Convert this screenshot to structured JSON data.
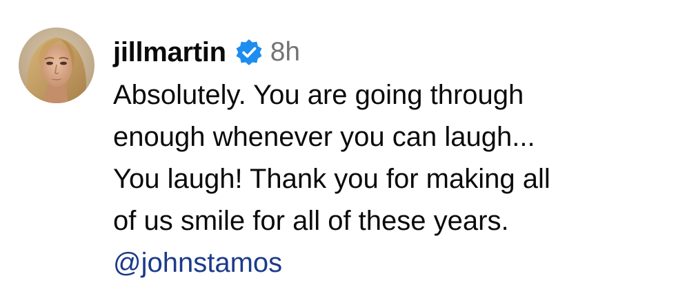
{
  "comment": {
    "username": "jillmartin",
    "verified_icon": "verified-badge-icon",
    "timestamp": "8h",
    "text_lines": [
      "Absolutely. You are going through",
      "enough whenever you can laugh...",
      "You laugh! Thank you for making all",
      "of us smile for all of these years."
    ],
    "mention": "@johnstamos"
  },
  "colors": {
    "text": "#0a0a0a",
    "timestamp": "#737373",
    "verified_badge": "#1d8df0",
    "mention": "#1b3a8a"
  }
}
